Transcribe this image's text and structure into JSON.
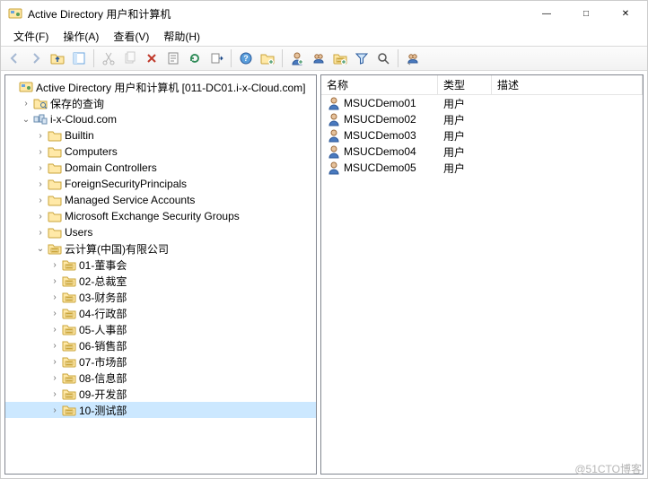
{
  "window": {
    "title": "Active Directory 用户和计算机"
  },
  "menu": {
    "file": "文件(F)",
    "action": "操作(A)",
    "view": "查看(V)",
    "help": "帮助(H)"
  },
  "toolbar": {
    "back": "back-arrow",
    "forward": "forward-arrow",
    "up": "up-folder",
    "show_hide_tree": "show-hide-console-tree",
    "cut": "cut",
    "copy": "copy",
    "delete": "delete",
    "properties": "properties",
    "refresh": "refresh",
    "export": "export-list",
    "help": "help",
    "new_container": "new-container",
    "new_user": "new-user",
    "new_group": "new-group",
    "new_ou": "new-ou",
    "filter": "filter",
    "find": "find",
    "add_criteria": "add-criteria"
  },
  "tree": {
    "root_label": "Active Directory 用户和计算机 [011-DC01.i-x-Cloud.com]",
    "saved_queries": "保存的查询",
    "domain": "i-x-Cloud.com",
    "containers": [
      "Builtin",
      "Computers",
      "Domain Controllers",
      "ForeignSecurityPrincipals",
      "Managed Service Accounts",
      "Microsoft Exchange Security Groups",
      "Users"
    ],
    "ou_company": "云计算(中国)有限公司",
    "ou_children": [
      "01-董事会",
      "02-总裁室",
      "03-财务部",
      "04-行政部",
      "05-人事部",
      "06-销售部",
      "07-市场部",
      "08-信息部",
      "09-开发部",
      "10-测试部"
    ],
    "selected": "10-测试部"
  },
  "list": {
    "columns": {
      "name": "名称",
      "type": "类型",
      "desc": "描述"
    },
    "rows": [
      {
        "name": "MSUCDemo01",
        "type": "用户",
        "desc": ""
      },
      {
        "name": "MSUCDemo02",
        "type": "用户",
        "desc": ""
      },
      {
        "name": "MSUCDemo03",
        "type": "用户",
        "desc": ""
      },
      {
        "name": "MSUCDemo04",
        "type": "用户",
        "desc": ""
      },
      {
        "name": "MSUCDemo05",
        "type": "用户",
        "desc": ""
      }
    ]
  },
  "watermark": "@51CTO博客"
}
